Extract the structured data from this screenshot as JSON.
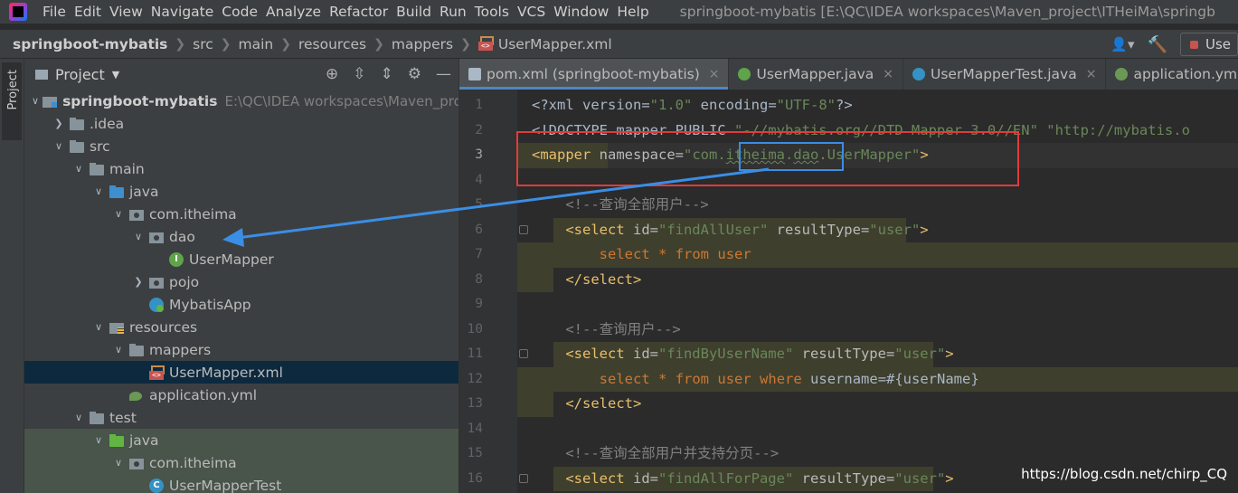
{
  "menubar": {
    "items": [
      "File",
      "Edit",
      "View",
      "Navigate",
      "Code",
      "Analyze",
      "Refactor",
      "Build",
      "Run",
      "Tools",
      "VCS",
      "Window",
      "Help"
    ],
    "window_title": "springboot-mybatis [E:\\QC\\IDEA workspaces\\Maven_project\\ITHeiMa\\springb"
  },
  "navbar": {
    "crumbs": [
      "springboot-mybatis",
      "src",
      "main",
      "resources",
      "mappers",
      "UserMapper.xml"
    ],
    "user_icon": "user-icon",
    "build_icon": "hammer-icon",
    "run_config_label": "Use"
  },
  "stripe": {
    "label": "Project"
  },
  "project": {
    "title": "Project",
    "tools": [
      "locate-icon",
      "expand-icon",
      "collapse-icon",
      "gear-icon",
      "minimize-icon"
    ],
    "tree": [
      {
        "name": "springboot-mybatis",
        "hint": "E:\\QC\\IDEA workspaces\\Maven_proje",
        "icon": "modfolder",
        "chev": "down",
        "depth": 0,
        "bold": true
      },
      {
        "name": ".idea",
        "icon": "folder",
        "chev": "right",
        "depth": 1
      },
      {
        "name": "src",
        "icon": "folder",
        "chev": "down",
        "depth": 1
      },
      {
        "name": "main",
        "icon": "folder",
        "chev": "down",
        "depth": 2
      },
      {
        "name": "java",
        "icon": "folder-blue",
        "chev": "down",
        "depth": 3
      },
      {
        "name": "com.itheima",
        "icon": "pkg",
        "chev": "down",
        "depth": 4
      },
      {
        "name": "dao",
        "icon": "pkg",
        "chev": "down",
        "depth": 5
      },
      {
        "name": "UserMapper",
        "icon": "iface",
        "chev": "",
        "depth": 6
      },
      {
        "name": "pojo",
        "icon": "pkg",
        "chev": "right",
        "depth": 5
      },
      {
        "name": "MybatisApp",
        "icon": "app",
        "chev": "",
        "depth": 5
      },
      {
        "name": "resources",
        "icon": "res",
        "chev": "down",
        "depth": 3
      },
      {
        "name": "mappers",
        "icon": "folder",
        "chev": "down",
        "depth": 4
      },
      {
        "name": "UserMapper.xml",
        "icon": "xml",
        "chev": "",
        "depth": 5,
        "selected": true
      },
      {
        "name": "application.yml",
        "icon": "yml",
        "chev": "",
        "depth": 4
      },
      {
        "name": "test",
        "icon": "folder",
        "chev": "down",
        "depth": 2
      },
      {
        "name": "java",
        "icon": "folder-green",
        "chev": "down",
        "depth": 3,
        "test": true
      },
      {
        "name": "com.itheima",
        "icon": "pkg",
        "chev": "down",
        "depth": 4,
        "test": true
      },
      {
        "name": "UserMapperTest",
        "icon": "class",
        "chev": "",
        "depth": 5,
        "test": true
      }
    ]
  },
  "editor": {
    "tabs": [
      {
        "label": "pom.xml (springboot-mybatis)",
        "icon": "maven",
        "active": true
      },
      {
        "label": "UserMapper.java",
        "icon": "iface"
      },
      {
        "label": "UserMapperTest.java",
        "icon": "test"
      },
      {
        "label": "application.yml",
        "icon": "yml"
      }
    ],
    "line_numbers": [
      "1",
      "2",
      "3",
      "4",
      "5",
      "6",
      "7",
      "8",
      "9",
      "10",
      "11",
      "12",
      "13",
      "14",
      "15",
      "16"
    ],
    "current_line": 3,
    "lines": [
      [
        [
          "t-plain",
          "<?xml version="
        ],
        [
          "t-str",
          "\"1.0\""
        ],
        [
          "t-plain",
          " encoding="
        ],
        [
          "t-str",
          "\"UTF-8\""
        ],
        [
          "t-plain",
          "?>"
        ]
      ],
      [
        [
          "t-plain",
          "<!DOCTYPE mapper PUBLIC "
        ],
        [
          "t-str",
          "\"-//mybatis.org//DTD Mapper 3.0//EN\""
        ],
        [
          "t-plain",
          " "
        ],
        [
          "t-str",
          "\"http://mybatis.o"
        ]
      ],
      [
        [
          "t-tag",
          "<mapper"
        ],
        [
          "t-attr",
          " namespace="
        ],
        [
          "t-str",
          "\"com."
        ],
        [
          "t-ns",
          "itheima"
        ],
        [
          "t-str",
          "."
        ],
        [
          "t-ns",
          "dao"
        ],
        [
          "t-str",
          ".UserMapper\""
        ],
        [
          "t-tag",
          ">"
        ]
      ],
      [],
      [
        [
          "t-comm",
          "    <!--查询全部用户-->"
        ]
      ],
      [
        [
          "t-plain",
          "    "
        ],
        [
          "t-tag",
          "<select"
        ],
        [
          "t-attr",
          " id="
        ],
        [
          "t-str",
          "\"findAllUser\""
        ],
        [
          "t-attr",
          " resultType="
        ],
        [
          "t-str",
          "\"user\""
        ],
        [
          "t-tag",
          ">"
        ]
      ],
      [
        [
          "t-plain",
          "        "
        ],
        [
          "t-sqlkw",
          "select"
        ],
        [
          "t-plain",
          " "
        ],
        [
          "t-sqlkw",
          "*"
        ],
        [
          "t-plain",
          " "
        ],
        [
          "t-sqlkw",
          "from"
        ],
        [
          "t-plain",
          " "
        ],
        [
          "t-kw",
          "user"
        ]
      ],
      [
        [
          "t-plain",
          "    "
        ],
        [
          "t-tag",
          "</select>"
        ]
      ],
      [],
      [
        [
          "t-comm",
          "    <!--查询用户-->"
        ]
      ],
      [
        [
          "t-plain",
          "    "
        ],
        [
          "t-tag",
          "<select"
        ],
        [
          "t-attr",
          " id="
        ],
        [
          "t-str",
          "\"findByUserName\""
        ],
        [
          "t-attr",
          " resultType="
        ],
        [
          "t-str",
          "\"user\""
        ],
        [
          "t-tag",
          ">"
        ]
      ],
      [
        [
          "t-plain",
          "        "
        ],
        [
          "t-sqlkw",
          "select"
        ],
        [
          "t-plain",
          " "
        ],
        [
          "t-sqlkw",
          "*"
        ],
        [
          "t-plain",
          " "
        ],
        [
          "t-sqlkw",
          "from"
        ],
        [
          "t-plain",
          " "
        ],
        [
          "t-kw",
          "user"
        ],
        [
          "t-plain",
          " "
        ],
        [
          "t-sqlkw",
          "where"
        ],
        [
          "t-plain",
          " username=#{userName}"
        ]
      ],
      [
        [
          "t-plain",
          "    "
        ],
        [
          "t-tag",
          "</select>"
        ]
      ],
      [],
      [
        [
          "t-comm",
          "    <!--查询全部用户并支持分页-->"
        ]
      ],
      [
        [
          "t-plain",
          "    "
        ],
        [
          "t-tag",
          "<select"
        ],
        [
          "t-attr",
          " id="
        ],
        [
          "t-str",
          "\"findAllForPage\""
        ],
        [
          "t-attr",
          " resultType="
        ],
        [
          "t-str",
          "\"user\""
        ],
        [
          "t-tag",
          ">"
        ]
      ]
    ]
  },
  "watermark": "https://blog.csdn.net/chirp_CQ",
  "colors": {
    "annotation_red": "#e23b3b",
    "annotation_blue": "#3a8ee6"
  }
}
